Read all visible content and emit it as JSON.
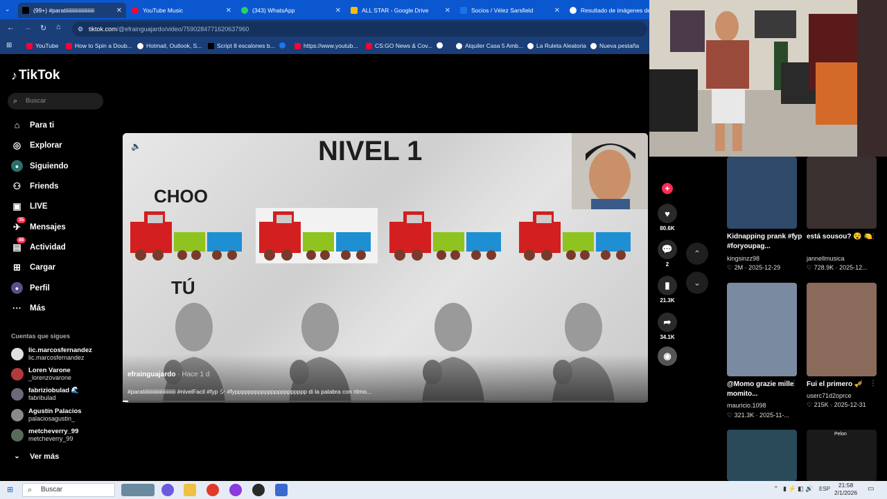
{
  "browser": {
    "tabs": [
      {
        "label": "(99+) #paratiiiiiiiiiiiiiiiiiiiiii",
        "color": "#000000"
      },
      {
        "label": "YouTube Music",
        "color": "#ff0033"
      },
      {
        "label": "(343) WhatsApp",
        "color": "#25d366"
      },
      {
        "label": "ALL STAR - Google Drive",
        "color": "#fbbc04"
      },
      {
        "label": "Socios / Vélez Sarsfield",
        "color": "#1a73e8"
      },
      {
        "label": "Resultado de imágenes de G",
        "color": "#ffffff"
      }
    ],
    "url_host": "tiktok.com",
    "url_path": "/@efrainguajardo/video/7590284771620637960",
    "bookmarks": [
      {
        "label": "YouTube",
        "color": "#ff0033"
      },
      {
        "label": "How to Spin a Doub...",
        "color": "#ff0033"
      },
      {
        "label": "Hotmail, Outlook, S...",
        "color": "#ffffff"
      },
      {
        "label": "Script 8 escalones b...",
        "color": "#000000"
      },
      {
        "label": "",
        "color": "#1877f2"
      },
      {
        "label": "https://www.youtub...",
        "color": "#ff0033"
      },
      {
        "label": "CS:GO News & Cov...",
        "color": "#ff0033"
      },
      {
        "label": "",
        "color": "#ffffff"
      },
      {
        "label": "Alquiler Casa 5 Amb...",
        "color": "#ffffff"
      },
      {
        "label": "La Ruleta Aleatoria",
        "color": "#ffffff"
      },
      {
        "label": "Nueva pestaña",
        "color": "#ffffff"
      }
    ]
  },
  "sidebar": {
    "logo": "TikTok",
    "search_placeholder": "Buscar",
    "items": [
      {
        "label": "Para ti",
        "icon": "home-icon",
        "glyph": "⌂"
      },
      {
        "label": "Explorar",
        "icon": "compass-icon",
        "glyph": "◎"
      },
      {
        "label": "Siguiendo",
        "icon": "following-avatar-icon",
        "glyph": "●"
      },
      {
        "label": "Friends",
        "icon": "friends-icon",
        "glyph": "👥"
      },
      {
        "label": "LIVE",
        "icon": "live-icon",
        "glyph": "▣"
      },
      {
        "label": "Mensajes",
        "icon": "messages-icon",
        "glyph": "✈",
        "badge": "35"
      },
      {
        "label": "Actividad",
        "icon": "activity-icon",
        "glyph": "▤",
        "badge": "88"
      },
      {
        "label": "Cargar",
        "icon": "upload-icon",
        "glyph": "⊞"
      },
      {
        "label": "Perfil",
        "icon": "profile-avatar-icon",
        "glyph": "●"
      },
      {
        "label": "Más",
        "icon": "more-icon",
        "glyph": "···"
      }
    ],
    "following_title": "Cuentas que sigues",
    "accounts": [
      {
        "name": "lic.marcosfernandez",
        "handle": "lic.marcosfernandez",
        "color": "#dddddd"
      },
      {
        "name": "Loren Varone",
        "handle": "_lorenzovarone",
        "color": "#b33a3a"
      },
      {
        "name": "fabriziobulad 🌊",
        "handle": "fabribulad",
        "color": "#6a6a7a"
      },
      {
        "name": "Agustín Palacios",
        "handle": "palaciosagustin_",
        "color": "#8a8a8a"
      },
      {
        "name": "metcheverry_99",
        "handle": "metcheverry_99",
        "color": "#5a6a5a"
      }
    ],
    "see_more": "Ver más"
  },
  "video": {
    "title_text": "NIVEL 1",
    "row1_label": "CHOO",
    "row2_label": "TÚ",
    "author": "efrainguajardo",
    "time": "· Hace 1 d",
    "caption": "#paratiiiiiiiiiiiiiiiiiiiiiiii #nivelFacil #fyp シ #fypppppppppppppppppppppp  di la palabra con ritmo...",
    "progress": 0.01
  },
  "actions": {
    "likes": "80.6K",
    "comments": "2",
    "saves": "21.3K",
    "shares": "34.1K"
  },
  "grid": [
    {
      "title": "Kidnapping prank #fyp #foryoupag...",
      "user": "kingsinzz98",
      "meta": "♡ 2M · 2025-12-29",
      "color": "#2f4a6a"
    },
    {
      "title": "está sousou? 😵 🍋",
      "user": "jannellmusica",
      "meta": "♡ 728.9K · 2025-12...",
      "color": "#3a3030"
    },
    {
      "title": "@Momo grazie mille momito...",
      "user": "mauricio.1098",
      "meta": "♡ 321.3K · 2025-11-...",
      "color": "#7a8aa0"
    },
    {
      "title": "Fui el primero 🎺",
      "user": "userc71d2oprce",
      "meta": "♡ 215K · 2025-12-31",
      "color": "#8a6a5a"
    },
    {
      "title": "",
      "user": "",
      "meta": "",
      "color": "#2a4a5a"
    },
    {
      "title": "Pelon",
      "user": "",
      "meta": "",
      "color": "#1a1a1a"
    }
  ],
  "taskbar": {
    "search": "Buscar",
    "lang": "ESP",
    "time": "21:58",
    "date": "2/1/2026"
  }
}
